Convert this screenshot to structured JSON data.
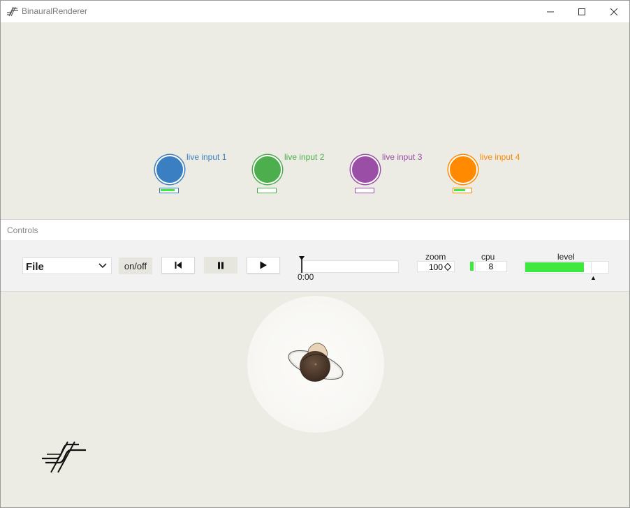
{
  "window": {
    "title": "BinauralRenderer",
    "controls": [
      "minimize",
      "maximize",
      "close"
    ]
  },
  "sources": [
    {
      "label": "live input 1",
      "color": "#3a7fc1",
      "level": 0.85
    },
    {
      "label": "live input 2",
      "color": "#4cae4c",
      "level": 0.0
    },
    {
      "label": "live input 3",
      "color": "#9b4ea6",
      "level": 0.0
    },
    {
      "label": "live input 4",
      "color": "#ff8a00",
      "level": 0.7
    }
  ],
  "controls": {
    "panel_label": "Controls",
    "source_select": {
      "value": "File"
    },
    "onoff_label": "on/off",
    "transport": [
      "skip-to-start",
      "pause",
      "play"
    ],
    "time": "0:00",
    "zoom": {
      "label": "zoom",
      "value": "100"
    },
    "cpu": {
      "label": "cpu",
      "value": "8"
    },
    "level": {
      "label": "level",
      "value": 0.7
    }
  },
  "colors": {
    "meter_green": "#3ee83e",
    "background": "#ecebe4"
  },
  "icons": {
    "app": "binaural-logo-icon",
    "listener": "listener-head-icon"
  }
}
